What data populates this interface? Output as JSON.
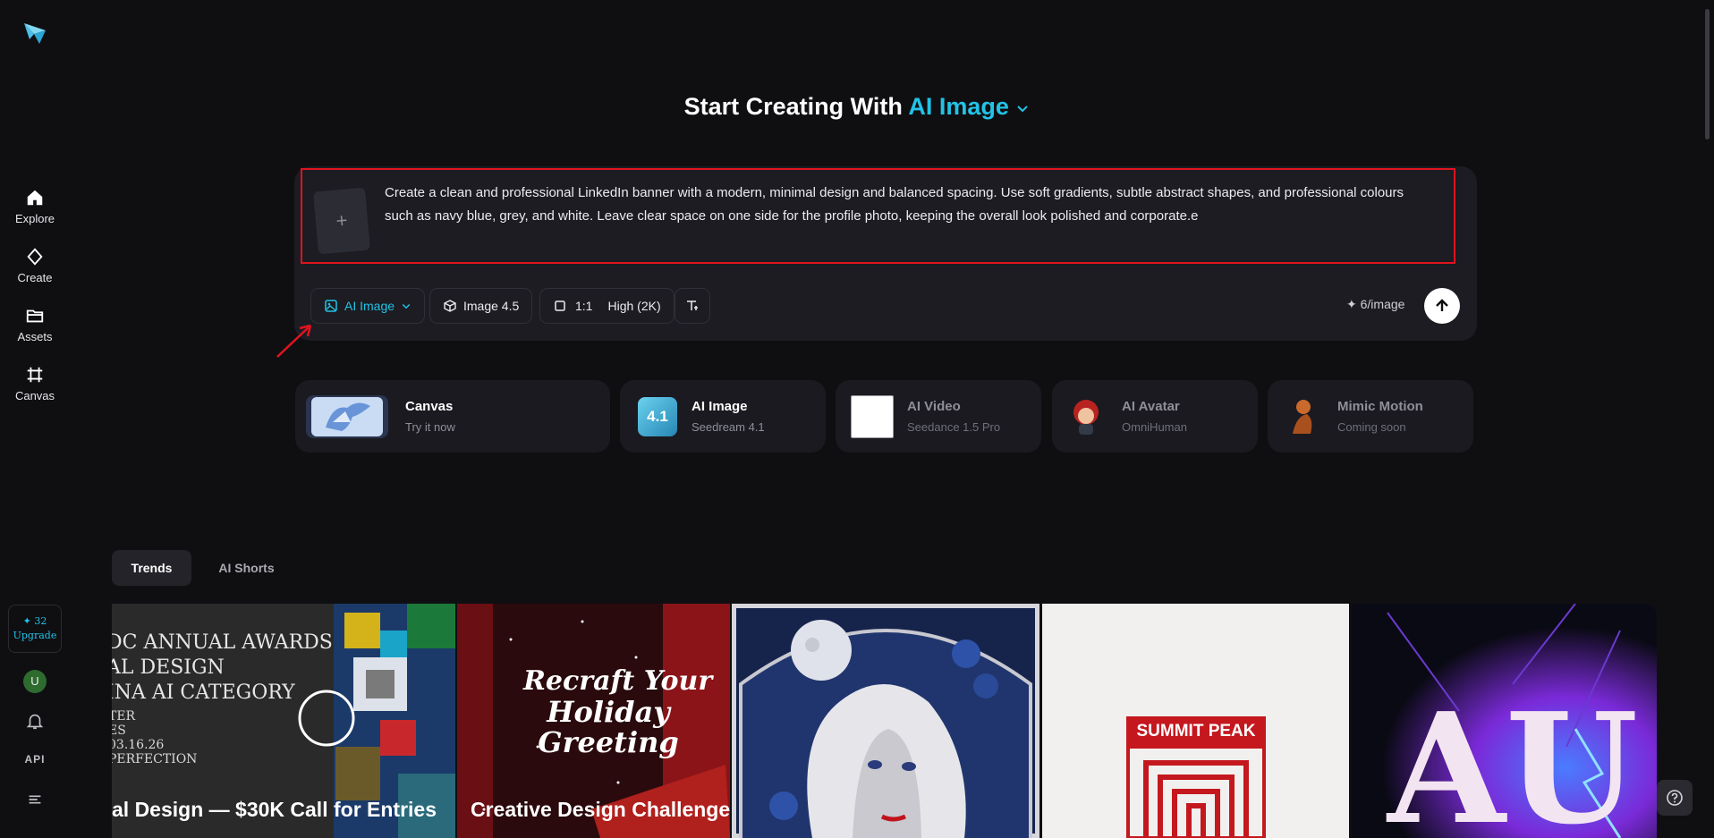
{
  "sidebar": {
    "items": [
      {
        "label": "Explore",
        "icon": "home-icon"
      },
      {
        "label": "Create",
        "icon": "diamond-icon"
      },
      {
        "label": "Assets",
        "icon": "folder-icon"
      },
      {
        "label": "Canvas",
        "icon": "canvas-icon"
      }
    ],
    "credits": {
      "count": "✦ 32",
      "upgrade_label": "Upgrade"
    },
    "avatar_letter": "U",
    "api_label": "API"
  },
  "heading": {
    "prefix": "Start Creating With",
    "mode": "AI Image"
  },
  "prompt": {
    "text": "Create a clean and professional LinkedIn banner with a modern, minimal design and balanced spacing. Use soft gradients, subtle abstract shapes, and professional colours such as navy blue, grey, and white. Leave clear space on one side for the profile photo, keeping the overall look polished and corporate.e",
    "add_symbol": "+"
  },
  "toolbar": {
    "mode_label": "AI Image",
    "model_label": "Image 4.5",
    "ratio_label": "1:1",
    "quality_label": "High (2K)",
    "cost_label": "✦ 6/image"
  },
  "features": [
    {
      "title": "Canvas",
      "subtitle": "Try it now"
    },
    {
      "title": "AI Image",
      "subtitle": "Seedream 4.1",
      "badge": "4.1"
    },
    {
      "title": "AI Video",
      "subtitle": "Seedance 1.5 Pro"
    },
    {
      "title": "AI Avatar",
      "subtitle": "OmniHuman"
    },
    {
      "title": "Mimic Motion",
      "subtitle": "Coming soon"
    }
  ],
  "tabs": [
    {
      "label": "Trends"
    },
    {
      "label": "AI Shorts"
    }
  ],
  "gallery": [
    {
      "caption": "al Design — $30K Call for Entries",
      "art_lines": [
        "DC ANNUAL AWARDS",
        "AL DESIGN",
        "INA AI CATEGORY",
        "TER",
        "ES",
        "03.16.26",
        "PERFECTION"
      ]
    },
    {
      "caption": "Creative Design Challenge",
      "art_lines": [
        "Recraft Your",
        "Holiday",
        "Greeting"
      ]
    },
    {
      "caption": ""
    },
    {
      "caption": "",
      "art_lines": [
        "SUMMIT PEAK"
      ]
    },
    {
      "caption": "",
      "art_lines": [
        "AU"
      ]
    }
  ],
  "colors": {
    "accent": "#22c3e6",
    "background": "#0f0f12",
    "highlight": "#e0131f"
  }
}
